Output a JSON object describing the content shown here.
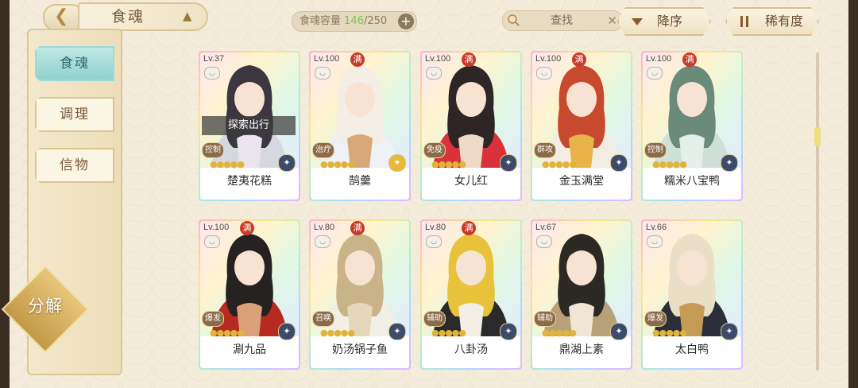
{
  "topbar": {
    "back_icon": "back-arrow-icon",
    "title": "食魂",
    "capacity": {
      "label": "食魂容量",
      "current": "146",
      "separator": "/",
      "max": "250"
    },
    "search": {
      "placeholder": "查找"
    },
    "sort": {
      "order_label": "降序",
      "by_label": "稀有度"
    }
  },
  "sidebar": {
    "tabs": [
      {
        "label": "食魂",
        "active": true
      },
      {
        "label": "调理",
        "active": false
      },
      {
        "label": "信物",
        "active": false
      }
    ],
    "decompose_label": "分解"
  },
  "cards": [
    {
      "level": "Lv.37",
      "full": "",
      "role": "控制",
      "name": "楚夷花糕",
      "status": "探索出行",
      "stars": 5,
      "emblem": "dark",
      "palette": [
        "#d5d8df",
        "#3b3640",
        "#e9e4ee"
      ]
    },
    {
      "level": "Lv.100",
      "full": "满",
      "role": "治疗",
      "name": "鹄羹",
      "status": "",
      "stars": 5,
      "emblem": "gold",
      "palette": [
        "#eef1f6",
        "#f4eee6",
        "#d8a87a"
      ]
    },
    {
      "level": "Lv.100",
      "full": "满",
      "role": "免疫",
      "name": "女儿红",
      "status": "",
      "stars": 5,
      "emblem": "dark",
      "palette": [
        "#d9323a",
        "#2e2626",
        "#f1d9c8"
      ]
    },
    {
      "level": "Lv.100",
      "full": "满",
      "role": "群攻",
      "name": "金玉满堂",
      "status": "",
      "stars": 5,
      "emblem": "dark",
      "palette": [
        "#f3ece2",
        "#c74a2e",
        "#e8b34a"
      ]
    },
    {
      "level": "Lv.100",
      "full": "满",
      "role": "控制",
      "name": "糯米八宝鸭",
      "status": "",
      "stars": 5,
      "emblem": "dark",
      "palette": [
        "#cfe0d8",
        "#6a8a7a",
        "#e3efe8"
      ]
    },
    {
      "level": "Lv.100",
      "full": "满",
      "role": "爆发",
      "name": "涮九品",
      "status": "",
      "stars": 5,
      "emblem": "dark",
      "palette": [
        "#b72a22",
        "#262222",
        "#d9a07a"
      ]
    },
    {
      "level": "Lv.80",
      "full": "满",
      "role": "召唤",
      "name": "奶汤锅子鱼",
      "status": "",
      "stars": 5,
      "emblem": "dark",
      "palette": [
        "#f2efe6",
        "#c9b48a",
        "#e4d6b8"
      ]
    },
    {
      "level": "Lv.80",
      "full": "满",
      "role": "辅助",
      "name": "八卦汤",
      "status": "",
      "stars": 5,
      "emblem": "dark",
      "palette": [
        "#2a2a2a",
        "#e8c23a",
        "#f3efe6"
      ]
    },
    {
      "level": "Lv.67",
      "full": "",
      "role": "辅助",
      "name": "鼎湖上素",
      "status": "",
      "stars": 5,
      "emblem": "dark",
      "palette": [
        "#b8a17a",
        "#2c2824",
        "#efe6d6"
      ]
    },
    {
      "level": "Lv.66",
      "full": "",
      "role": "爆发",
      "name": "太白鸭",
      "status": "",
      "stars": 5,
      "emblem": "dark",
      "palette": [
        "#2a2f3a",
        "#eadfc6",
        "#c59a55"
      ]
    }
  ]
}
